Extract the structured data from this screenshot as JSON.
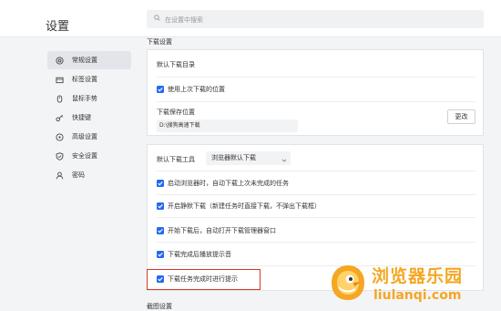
{
  "app_title": "设置",
  "search": {
    "placeholder": "在设置中搜索"
  },
  "sidebar": {
    "items": [
      {
        "label": "常规设置",
        "icon": "settings-circle-icon",
        "active": true
      },
      {
        "label": "标签设置",
        "icon": "tab-icon",
        "active": false
      },
      {
        "label": "鼠标手势",
        "icon": "mouse-icon",
        "active": false
      },
      {
        "label": "快捷键",
        "icon": "key-icon",
        "active": false
      },
      {
        "label": "高级设置",
        "icon": "advanced-icon",
        "active": false
      },
      {
        "label": "安全设置",
        "icon": "shield-icon",
        "active": false
      },
      {
        "label": "密码",
        "icon": "user-icon",
        "active": false
      }
    ]
  },
  "download": {
    "section_title": "下载设置",
    "default_dir_label": "默认下载目录",
    "use_last_location": "使用上次下载的位置",
    "save_location_label": "下载保存位置",
    "save_path": "D:\\搜狗高速下载",
    "change_button": "更改",
    "default_tool_label": "默认下载工具",
    "default_tool_value": "浏览器默认下载",
    "options": [
      "启动浏览器时，自动下载上次未完成的任务",
      "开启静默下载（新建任务时直接下载，不弹出下载框）",
      "开始下载后，自动打开下载管理器窗口",
      "下载完成后播放提示音",
      "下载任务完成时进行提示"
    ]
  },
  "next_section_title": "截图设置",
  "watermark": {
    "text": "浏览器乐园",
    "url": "liulanqi.com"
  },
  "colors": {
    "accent": "#2468f2",
    "highlight": "#d9362b",
    "watermark": "#f5a623"
  }
}
